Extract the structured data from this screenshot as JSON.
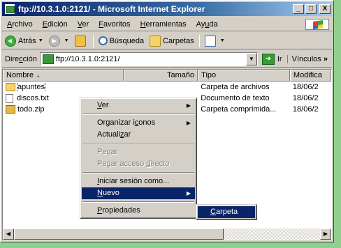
{
  "window": {
    "title": "ftp://10.3.1.0:2121/ - Microsoft Internet Explorer",
    "minimize": "_",
    "maximize": "□",
    "close": "X"
  },
  "menubar": [
    {
      "accel": "A",
      "rest": "rchivo"
    },
    {
      "accel": "E",
      "rest": "dición"
    },
    {
      "accel": "V",
      "rest": "er"
    },
    {
      "accel": "F",
      "rest": "avoritos"
    },
    {
      "accel": "H",
      "rest": "erramientas"
    },
    {
      "pre": "Ay",
      "accel": "u",
      "rest": "da"
    }
  ],
  "toolbar": {
    "back": "Atrás",
    "search": "Búsqueda",
    "folders": "Carpetas"
  },
  "address": {
    "label_pre": "Dire",
    "label_accel": "c",
    "label_post": "ción",
    "url": "ftp://10.3.1.0:2121/",
    "go": "Ir",
    "links": "Vínculos",
    "links_chevron": "»"
  },
  "columns": [
    "Nombre",
    "Tamaño",
    "Tipo",
    "Modifica"
  ],
  "sort_indicator": "▲",
  "files": [
    {
      "name": "apuntes",
      "icon": "folder-icon",
      "type": "Carpeta de archivos",
      "modified": "18/06/2"
    },
    {
      "name": "discos.txt",
      "icon": "text-file-icon",
      "type": "Documento de texto",
      "modified": "18/06/2"
    },
    {
      "name": "todo.zip",
      "icon": "zip-file-icon",
      "type": "Carpeta comprimida...",
      "modified": "18/06/2"
    }
  ],
  "context_menu": {
    "ver": {
      "accel": "V",
      "rest": "er"
    },
    "organizar": {
      "pre": "Organizar i",
      "accel": "c",
      "rest": "onos"
    },
    "actualizar": {
      "pre": "Actuali",
      "accel": "z",
      "rest": "ar"
    },
    "pegar": {
      "pre": "Pe",
      "accel": "g",
      "rest": "ar"
    },
    "pegar_acceso": {
      "pre": "Pegar acceso ",
      "accel": "d",
      "rest": "irecto"
    },
    "iniciar": {
      "accel": "I",
      "rest": "niciar sesión como..."
    },
    "nuevo": {
      "accel": "N",
      "rest": "uevo"
    },
    "propiedades": {
      "accel": "P",
      "rest": "ropiedades"
    }
  },
  "submenu": {
    "carpeta": {
      "accel": "C",
      "rest": "arpeta"
    }
  },
  "colors": {
    "titlebar_start": "#0a246a",
    "titlebar_end": "#a6caf0",
    "highlight": "#0a246a",
    "background": "#8fd08f"
  }
}
